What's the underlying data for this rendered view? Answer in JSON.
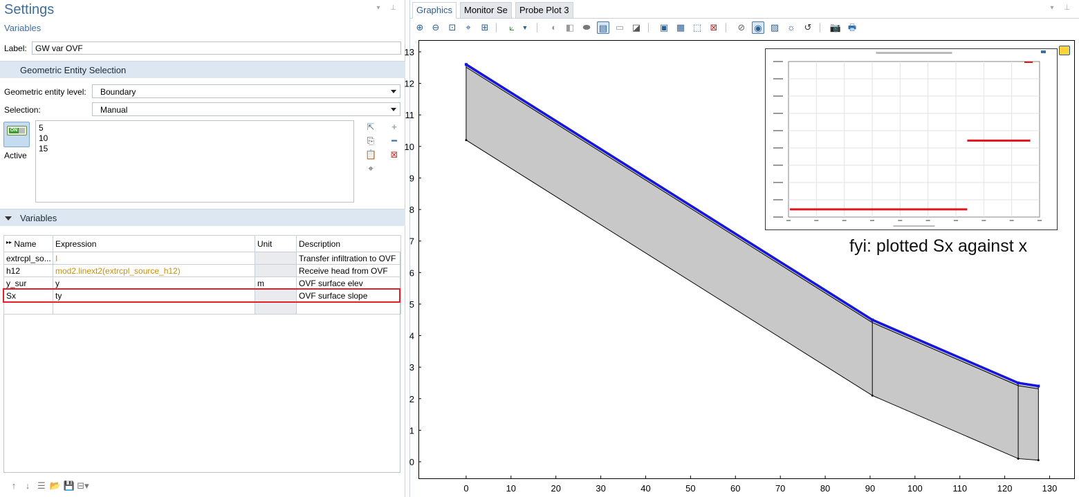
{
  "settings": {
    "title": "Settings",
    "subtitle": "Variables",
    "label_caption": "Label:",
    "label_value": "GW var OVF"
  },
  "geo_section": {
    "title": "Geometric Entity Selection",
    "entity_level_label": "Geometric entity level:",
    "entity_level_value": "Boundary",
    "selection_label": "Selection:",
    "selection_value": "Manual",
    "active_label": "Active",
    "toggle_text": "ON",
    "selected_items": [
      "5",
      "10",
      "15"
    ]
  },
  "variables_section": {
    "title": "Variables",
    "columns": [
      "Name",
      "Expression",
      "Unit",
      "Description"
    ],
    "rows": [
      {
        "name": "extrcpl_so...",
        "expression": "I",
        "unit": "",
        "description": "Transfer infiltration to OVF"
      },
      {
        "name": "h12",
        "expression": "mod2.linext2(extrcpl_source_h12)",
        "unit": "",
        "description": "Receive head from OVF"
      },
      {
        "name": "y_sur",
        "expression": "y",
        "unit": "m",
        "description": "OVF surface elev"
      },
      {
        "name": "Sx",
        "expression": "ty",
        "unit": "",
        "description": "OVF surface slope"
      }
    ]
  },
  "graphics": {
    "tabs": [
      "Graphics",
      "Monitor Se",
      "Probe Plot 3"
    ],
    "annotation": "fyi: plotted Sx against x",
    "x_ticks": [
      "0",
      "10",
      "20",
      "30",
      "40",
      "50",
      "60",
      "70",
      "80",
      "90",
      "100",
      "110",
      "120",
      "130"
    ],
    "y_ticks": [
      "0",
      "1",
      "2",
      "3",
      "4",
      "5",
      "6",
      "7",
      "8",
      "9",
      "10",
      "11",
      "12",
      "13"
    ],
    "colors": {
      "boundary": "#1515e0",
      "fill": "#c8c8c8",
      "highlight": "#e3202a",
      "step": "#e0141c"
    }
  },
  "chart_data": [
    {
      "type": "area",
      "title": "",
      "xlabel": "",
      "ylabel": "",
      "xlim": [
        -6,
        133
      ],
      "ylim": [
        -0.6,
        13.3
      ],
      "series": [
        {
          "values": [
            [
              0,
              12.6
            ],
            [
              90.5,
              4.5
            ],
            [
              123,
              2.5
            ],
            [
              127.5,
              2.4
            ]
          ]
        },
        {
          "values": [
            [
              0,
              10.2
            ],
            [
              90.5,
              2.1
            ],
            [
              123,
              0.1
            ],
            [
              127.5,
              0.05
            ]
          ]
        }
      ],
      "grid": false
    },
    {
      "type": "line",
      "title": "",
      "xlabel": "",
      "ylabel": "",
      "series": [
        {
          "values": [
            [
              0,
              -0.089
            ],
            [
              90,
              -0.089
            ],
            [
              90,
              -0.062
            ],
            [
              122,
              -0.062
            ]
          ]
        }
      ],
      "grid": true
    }
  ]
}
